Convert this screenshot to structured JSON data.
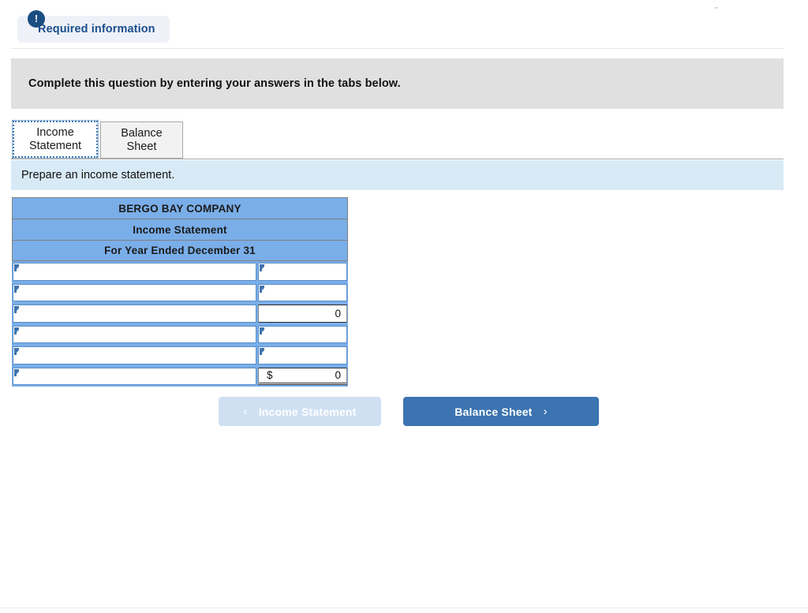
{
  "header": {
    "badge_label": "Required information",
    "badge_icon": "exclamation-icon"
  },
  "instruction_banner": {
    "text": "Complete this question by entering your answers in the tabs below."
  },
  "tabs": [
    {
      "label": "Income Statement",
      "active": true
    },
    {
      "label": "Balance Sheet",
      "active": false
    }
  ],
  "prompt": {
    "text": "Prepare an income statement."
  },
  "worksheet": {
    "title_rows": [
      "BERGO BAY COMPANY",
      "Income Statement",
      "For Year Ended December 31"
    ],
    "rows": [
      {
        "label": "",
        "amount": "",
        "type": "input",
        "currency": ""
      },
      {
        "label": "",
        "amount": "",
        "type": "input",
        "currency": ""
      },
      {
        "label": "",
        "amount": "0",
        "type": "computed",
        "currency": ""
      },
      {
        "label": "",
        "amount": "",
        "type": "input",
        "currency": ""
      },
      {
        "label": "",
        "amount": "",
        "type": "input",
        "currency": ""
      },
      {
        "label": "",
        "amount": "0",
        "type": "total",
        "currency": "$"
      }
    ]
  },
  "footer": {
    "prev_label": "Income Statement",
    "prev_icon": "chevron-left-icon",
    "prev_disabled": true,
    "next_label": "Balance Sheet",
    "next_icon": "chevron-right-icon"
  },
  "colors": {
    "table_header_blue": "#7aaee8",
    "prompt_blue": "#d9eaf7",
    "banner_gray": "#e0e0e0",
    "accent_blue": "#3b74b0",
    "badge_navy": "#1b4d80"
  }
}
